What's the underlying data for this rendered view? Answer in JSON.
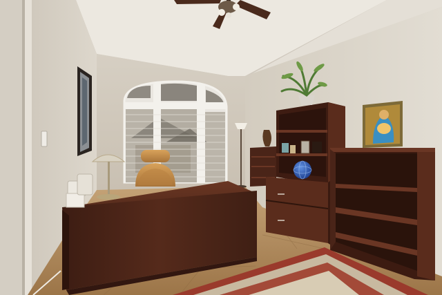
{
  "scene": {
    "kind": "photo-interior-home-office",
    "colors": {
      "wall_left": "#d9d3c8",
      "wall_back": "#d7d0c4",
      "wall_right": "#dcd6cb",
      "ceiling": "#ece8e0",
      "wood_dark": "#4a2418",
      "wood_mid": "#5e3020",
      "tile_floor": "#b08a5e",
      "rug_red": "#9a3a2c",
      "chair_tan": "#c8924a",
      "blind_white": "#e9e6e0",
      "roof_grey": "#7f7a72"
    },
    "objects": [
      {
        "name": "ceiling-fan",
        "label": ""
      },
      {
        "name": "arched-window-with-blinds",
        "label": ""
      },
      {
        "name": "wall-framed-picture",
        "label": ""
      },
      {
        "name": "executive-desk",
        "label": ""
      },
      {
        "name": "leather-office-chair",
        "label": ""
      },
      {
        "name": "desk-lamp",
        "label": ""
      },
      {
        "name": "floor-lamp",
        "label": ""
      },
      {
        "name": "corner-bookshelf",
        "label": ""
      },
      {
        "name": "cabinet-with-drawers",
        "label": ""
      },
      {
        "name": "open-bookcase",
        "label": ""
      },
      {
        "name": "potted-palm-plant",
        "label": ""
      },
      {
        "name": "religious-painting",
        "label": ""
      },
      {
        "name": "blue-decorative-sphere",
        "label": ""
      },
      {
        "name": "oriental-area-rug",
        "label": ""
      },
      {
        "name": "tile-floor",
        "label": ""
      }
    ]
  }
}
